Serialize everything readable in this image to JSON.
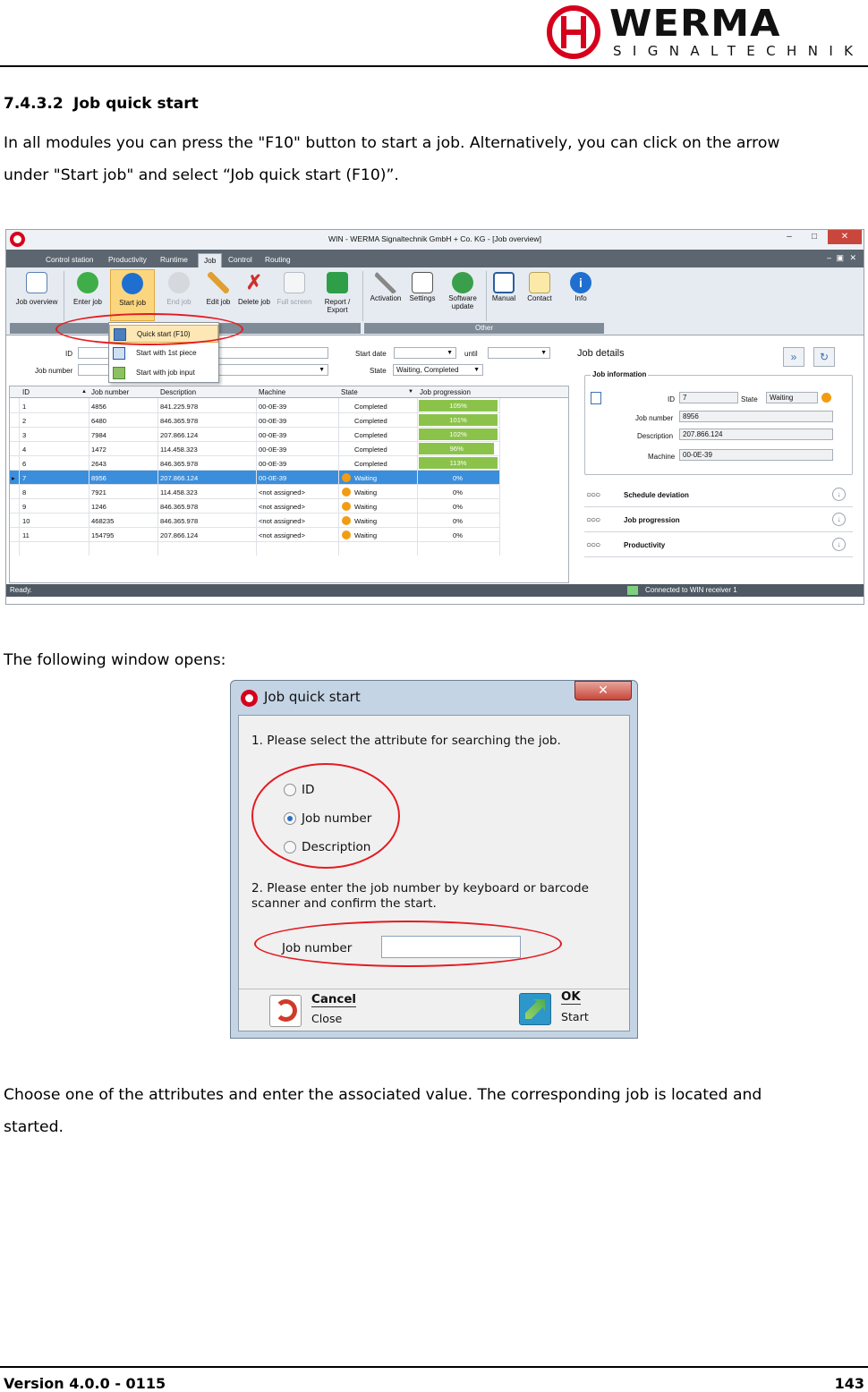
{
  "brand": {
    "name": "WERMA",
    "tagline": "SIGNALTECHNIK"
  },
  "section": {
    "number": "7.4.3.2",
    "title": "Job quick start"
  },
  "paragraphs": {
    "p1_line1": "In all modules you can press the \"F10\" button to start a job. Alternatively, you can click on the arrow",
    "p1_line2": "under \"Start job\" and select “Job quick start (F10)”.",
    "p2": "The following window opens:",
    "p3_line1": "Choose one of the attributes and enter the associated value. The corresponding job is located and",
    "p3_line2": "started."
  },
  "app": {
    "window_title": "WIN - WERMA Signaltechnik GmbH + Co. KG - [Job overview]",
    "tabs": [
      "Control station",
      "Productivity",
      "Runtime",
      "Job",
      "Control",
      "Routing"
    ],
    "active_tab": "Job",
    "ribbon": {
      "job_overview": "Job overview",
      "enter_job": "Enter job",
      "start_job": "Start job",
      "end_job": "End job",
      "edit_job": "Edit job",
      "delete_job": "Delete job",
      "full_screen": "Full screen",
      "report_export_1": "Report /",
      "report_export_2": "Export",
      "activation": "Activation",
      "settings": "Settings",
      "software_update_1": "Software",
      "software_update_2": "update",
      "manual": "Manual",
      "contact": "Contact",
      "info": "Info",
      "group_other": "Other"
    },
    "dropdown": [
      "Quick start (F10)",
      "Start with 1st piece",
      "Start with job input"
    ],
    "filters": {
      "id_label": "ID",
      "job_number_label": "Job number",
      "start_date_label": "Start date",
      "until_label": "until",
      "state_label": "State",
      "state_value": "Waiting, Completed"
    },
    "grid": {
      "columns": [
        "ID",
        "Job number",
        "Description",
        "Machine",
        "State",
        "Job progression"
      ],
      "rows": [
        {
          "id": "1",
          "job": "4856",
          "desc": "841.225.978",
          "machine": "00-0E-39",
          "state": "Completed",
          "prog": "105%"
        },
        {
          "id": "2",
          "job": "6480",
          "desc": "846.365.978",
          "machine": "00-0E-39",
          "state": "Completed",
          "prog": "101%"
        },
        {
          "id": "3",
          "job": "7984",
          "desc": "207.866.124",
          "machine": "00-0E-39",
          "state": "Completed",
          "prog": "102%"
        },
        {
          "id": "4",
          "job": "1472",
          "desc": "114.458.323",
          "machine": "00-0E-39",
          "state": "Completed",
          "prog": "96%"
        },
        {
          "id": "6",
          "job": "2643",
          "desc": "846.365.978",
          "machine": "00-0E-39",
          "state": "Completed",
          "prog": "113%"
        },
        {
          "id": "7",
          "job": "8956",
          "desc": "207.866.124",
          "machine": "00-0E-39",
          "state": "Waiting",
          "prog": "0%"
        },
        {
          "id": "8",
          "job": "7921",
          "desc": "114.458.323",
          "machine": "<not assigned>",
          "state": "Waiting",
          "prog": "0%"
        },
        {
          "id": "9",
          "job": "1246",
          "desc": "846.365.978",
          "machine": "<not assigned>",
          "state": "Waiting",
          "prog": "0%"
        },
        {
          "id": "10",
          "job": "468235",
          "desc": "846.365.978",
          "machine": "<not assigned>",
          "state": "Waiting",
          "prog": "0%"
        },
        {
          "id": "11",
          "job": "154795",
          "desc": "207.866.124",
          "machine": "<not assigned>",
          "state": "Waiting",
          "prog": "0%"
        }
      ]
    },
    "details": {
      "title": "Job details",
      "info_legend": "Job information",
      "id_label": "ID",
      "id_value": "7",
      "state_label": "State",
      "state_value": "Waiting",
      "job_number_label": "Job number",
      "job_number_value": "8956",
      "description_label": "Description",
      "description_value": "207.866.124",
      "machine_label": "Machine",
      "machine_value": "00-0E-39",
      "sections": [
        "Schedule deviation",
        "Job progression",
        "Productivity"
      ]
    },
    "status_left": "Ready.",
    "status_right": "Connected to WIN receiver 1"
  },
  "dialog": {
    "title": "Job quick start",
    "step1": "1. Please select the attribute for searching the job.",
    "options": [
      "ID",
      "Job number",
      "Description"
    ],
    "selected_option": "Job number",
    "step2_line1": "2. Please enter the job number by keyboard or barcode",
    "step2_line2": "scanner and confirm the start.",
    "input_label": "Job number",
    "input_value": "",
    "cancel_label": "Cancel",
    "cancel_sub": "Close",
    "ok_label": "OK",
    "ok_sub": "Start"
  },
  "footer": {
    "version": "Version 4.0.0 - 0115",
    "page": "143"
  },
  "colors": {
    "brand_red": "#d6001c",
    "annotation_red": "#e41b23",
    "progress_green": "#8bc34a",
    "waiting_orange": "#f39c12",
    "selection_blue": "#3b8edc"
  }
}
